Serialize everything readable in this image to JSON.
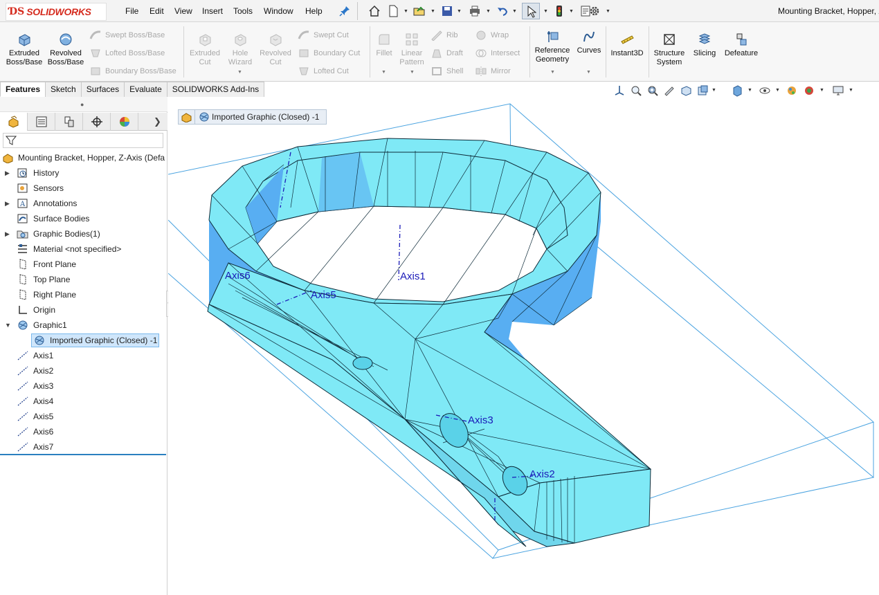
{
  "app": {
    "brand": "SOLIDWORKS",
    "document_title": "Mounting Bracket, Hopper, Z"
  },
  "menu": {
    "items": [
      "File",
      "Edit",
      "View",
      "Insert",
      "Tools",
      "Window",
      "Help"
    ]
  },
  "ribbon": {
    "extruded_boss": "Extruded\nBoss/Base",
    "revolved_boss": "Revolved\nBoss/Base",
    "swept_boss": "Swept Boss/Base",
    "lofted_boss": "Lofted Boss/Base",
    "boundary_boss": "Boundary Boss/Base",
    "extruded_cut": "Extruded\nCut",
    "hole_wizard": "Hole\nWizard",
    "revolved_cut": "Revolved\nCut",
    "swept_cut": "Swept Cut",
    "boundary_cut": "Boundary Cut",
    "lofted_cut": "Lofted Cut",
    "fillet": "Fillet",
    "linear_pattern": "Linear\nPattern",
    "rib": "Rib",
    "draft": "Draft",
    "shell": "Shell",
    "wrap": "Wrap",
    "intersect": "Intersect",
    "mirror": "Mirror",
    "reference_geometry": "Reference\nGeometry",
    "curves": "Curves",
    "instant3d": "Instant3D",
    "structure_system": "Structure\nSystem",
    "slicing": "Slicing",
    "defeature": "Defeature"
  },
  "tabs": [
    "Features",
    "Sketch",
    "Surfaces",
    "Evaluate",
    "SOLIDWORKS Add-Ins"
  ],
  "tree": {
    "root": "Mounting Bracket, Hopper, Z-Axis  (Defa",
    "items": [
      {
        "label": "History",
        "expandable": true
      },
      {
        "label": "Sensors",
        "expandable": false
      },
      {
        "label": "Annotations",
        "expandable": true
      },
      {
        "label": "Surface Bodies",
        "expandable": false
      },
      {
        "label": "Graphic Bodies(1)",
        "expandable": true
      },
      {
        "label": "Material <not specified>",
        "expandable": false
      },
      {
        "label": "Front Plane",
        "expandable": false
      },
      {
        "label": "Top Plane",
        "expandable": false
      },
      {
        "label": "Right Plane",
        "expandable": false
      },
      {
        "label": "Origin",
        "expandable": false
      },
      {
        "label": "Graphic1",
        "expandable": true
      },
      {
        "label": "Imported Graphic (Closed) -1",
        "expandable": false,
        "selected": true
      },
      {
        "label": "Axis1",
        "expandable": false
      },
      {
        "label": "Axis2",
        "expandable": false
      },
      {
        "label": "Axis3",
        "expandable": false
      },
      {
        "label": "Axis4",
        "expandable": false
      },
      {
        "label": "Axis5",
        "expandable": false
      },
      {
        "label": "Axis6",
        "expandable": false
      },
      {
        "label": "Axis7",
        "expandable": false
      }
    ]
  },
  "viewport": {
    "breadcrumb": "Imported Graphic (Closed) -1",
    "axis_labels": [
      "Axis1",
      "Axis2",
      "Axis3",
      "Axis5",
      "Axis6"
    ]
  },
  "colors": {
    "model_fill": "#7fe9f6",
    "model_dark": "#58aef2",
    "bounding_box": "#4aa3e0",
    "axis": "#1a1ab8",
    "selection": "#cfe6fb"
  }
}
